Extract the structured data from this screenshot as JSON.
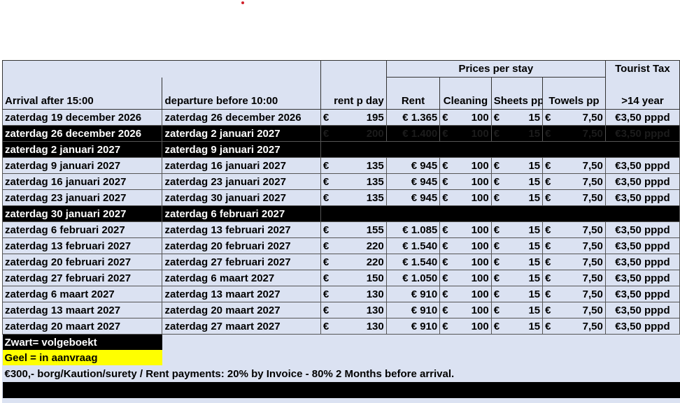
{
  "header": {
    "arrival": "Arrival after 15:00",
    "departure": "departure before 10:00",
    "rent_day": "rent p day",
    "prices_group": "Prices per stay",
    "rent": "Rent",
    "cleaning": "Cleaning",
    "sheets": "Sheets pp",
    "towels": "Towels pp",
    "tax_group": "Tourist Tax",
    "tax_age": ">14 year"
  },
  "currency": "€",
  "rows": [
    {
      "arrival": "zaterdag 19 december 2026",
      "departure": "zaterdag 26 december 2026",
      "rent_day": "195",
      "rent": "€ 1.365",
      "cleaning": "100",
      "sheets": "15",
      "towels": "7,50",
      "tax": "€3,50 pppd",
      "status": "open"
    },
    {
      "arrival": "zaterdag 26 december 2026",
      "departure": "zaterdag 2 januari 2027",
      "rent_day": "200",
      "rent": "€ 1.400",
      "cleaning": "100",
      "sheets": "15",
      "towels": "7,50",
      "tax": "€3,50 pppd",
      "status": "booked"
    },
    {
      "arrival": "zaterdag 2 januari 2027",
      "departure": "zaterdag 9 januari 2027",
      "status": "booked_blank"
    },
    {
      "arrival": "zaterdag 9 januari 2027",
      "departure": "zaterdag 16 januari 2027",
      "rent_day": "135",
      "rent": "€    945",
      "cleaning": "100",
      "sheets": "15",
      "towels": "7,50",
      "tax": "€3,50 pppd",
      "status": "open"
    },
    {
      "arrival": "zaterdag 16 januari 2027",
      "departure": "zaterdag 23 januari 2027",
      "rent_day": "135",
      "rent": "€    945",
      "cleaning": "100",
      "sheets": "15",
      "towels": "7,50",
      "tax": "€3,50 pppd",
      "status": "open"
    },
    {
      "arrival": "zaterdag 23 januari 2027",
      "departure": "zaterdag 30 januari 2027",
      "rent_day": "135",
      "rent": "€    945",
      "cleaning": "100",
      "sheets": "15",
      "towels": "7,50",
      "tax": "€3,50 pppd",
      "status": "open"
    },
    {
      "arrival": "zaterdag 30 januari 2027",
      "departure": "zaterdag 6 februari 2027",
      "status": "booked_blank"
    },
    {
      "arrival": "zaterdag 6 februari 2027",
      "departure": "zaterdag 13 februari 2027",
      "rent_day": "155",
      "rent": "€ 1.085",
      "cleaning": "100",
      "sheets": "15",
      "towels": "7,50",
      "tax": "€3,50 pppd",
      "status": "open"
    },
    {
      "arrival": "zaterdag 13 februari 2027",
      "departure": "zaterdag 20 februari 2027",
      "rent_day": "220",
      "rent": "€ 1.540",
      "cleaning": "100",
      "sheets": "15",
      "towels": "7,50",
      "tax": "€3,50 pppd",
      "status": "open"
    },
    {
      "arrival": "zaterdag 20 februari 2027",
      "departure": "zaterdag 27 februari 2027",
      "rent_day": "220",
      "rent": "€ 1.540",
      "cleaning": "100",
      "sheets": "15",
      "towels": "7,50",
      "tax": "€3,50 pppd",
      "status": "open"
    },
    {
      "arrival": "zaterdag 27 februari 2027",
      "departure": "zaterdag 6 maart 2027",
      "rent_day": "150",
      "rent": "€ 1.050",
      "cleaning": "100",
      "sheets": "15",
      "towels": "7,50",
      "tax": "€3,50 pppd",
      "status": "open"
    },
    {
      "arrival": "zaterdag 6 maart 2027",
      "departure": "zaterdag 13 maart 2027",
      "rent_day": "130",
      "rent": "€    910",
      "cleaning": "100",
      "sheets": "15",
      "towels": "7,50",
      "tax": "€3,50 pppd",
      "status": "open"
    },
    {
      "arrival": "zaterdag 13 maart 2027",
      "departure": "zaterdag 20 maart 2027",
      "rent_day": "130",
      "rent": "€    910",
      "cleaning": "100",
      "sheets": "15",
      "towels": "7,50",
      "tax": "€3,50 pppd",
      "status": "open"
    },
    {
      "arrival": "zaterdag 20 maart 2027",
      "departure": "zaterdag 27 maart 2027",
      "rent_day": "130",
      "rent": "€    910",
      "cleaning": "100",
      "sheets": "15",
      "towels": "7,50",
      "tax": "€3,50 pppd",
      "status": "open"
    }
  ],
  "legend": {
    "booked": "Zwart= volgeboekt",
    "requested": "Geel = in aanvraag"
  },
  "footer": "€300,- borg/Kaution/surety  / Rent payments: 20% by Invoice - 80% 2 Months before arrival.",
  "colors": {
    "header_bg": "#dbe2f2",
    "booked": "#000000",
    "requested": "#ffff00"
  }
}
